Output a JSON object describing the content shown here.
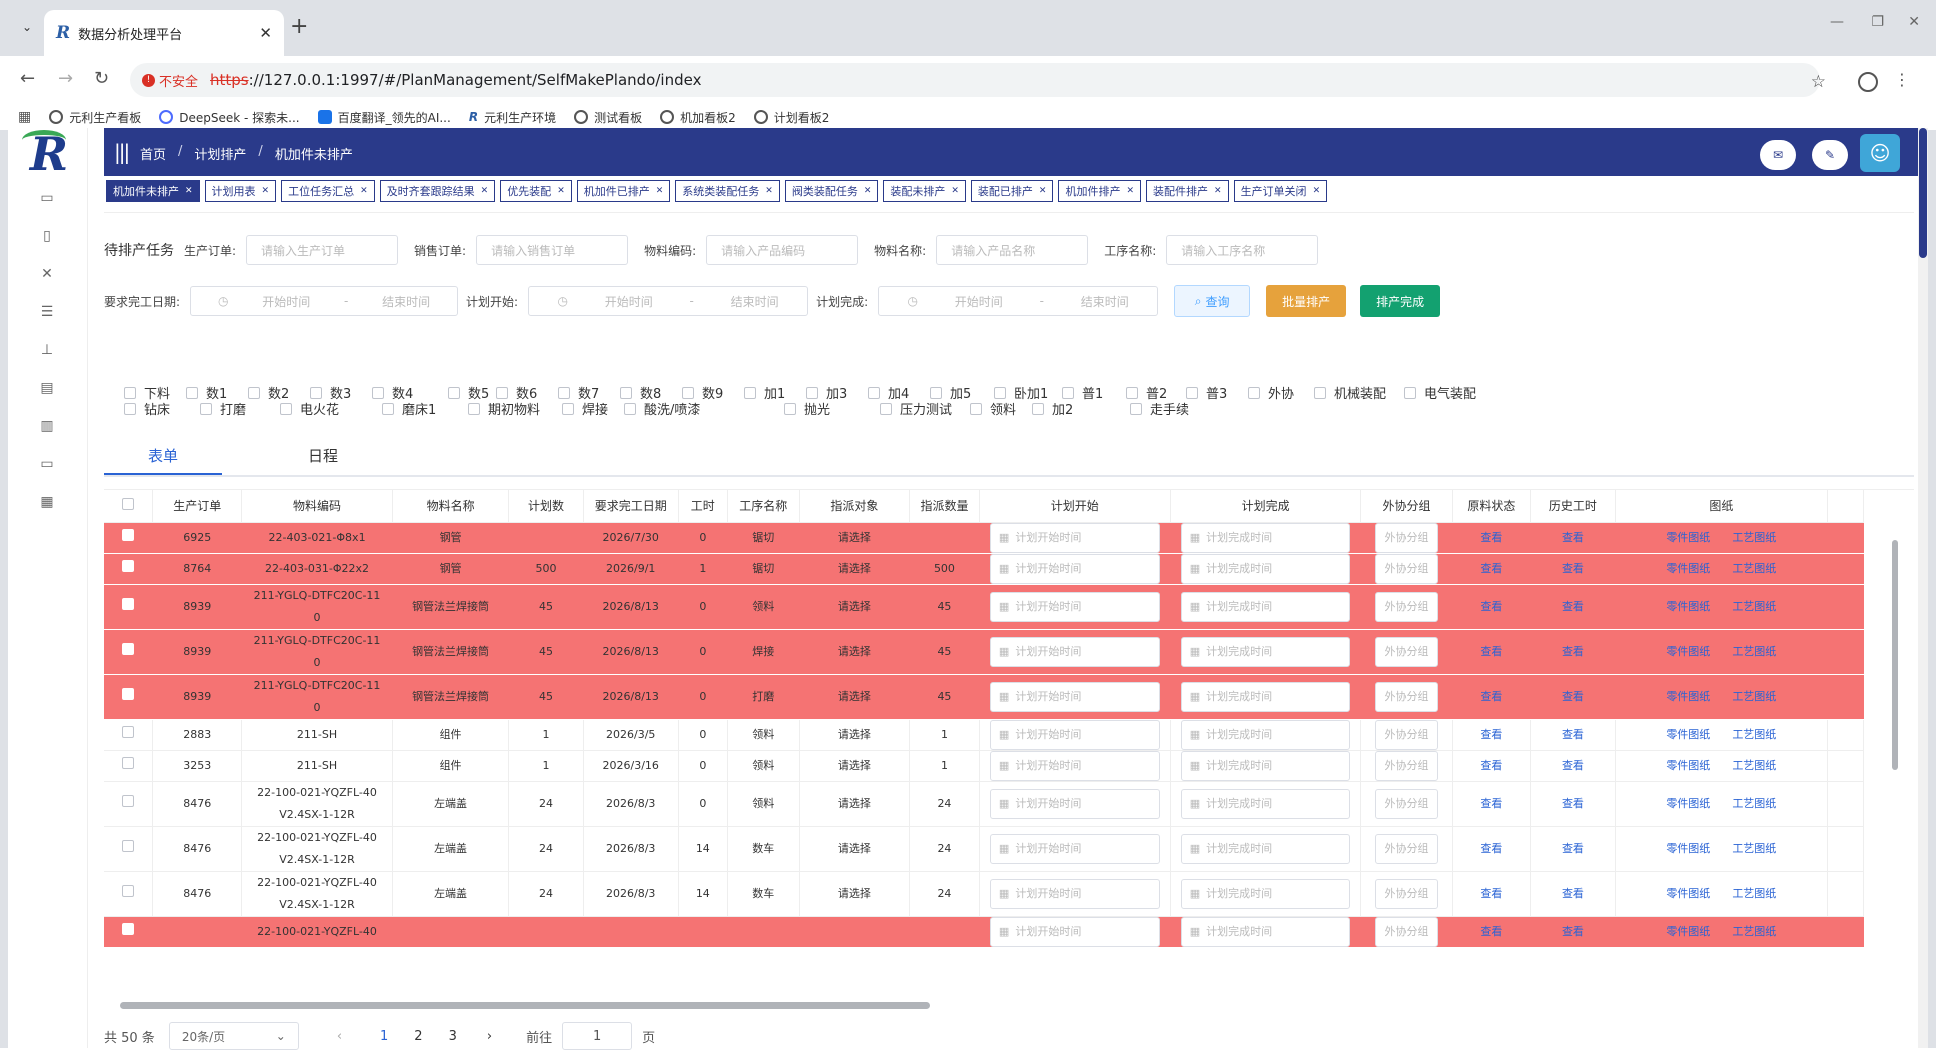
{
  "browser": {
    "tab_title": "数据分析处理平台",
    "insecure_label": "不安全",
    "url_scheme": "https",
    "url_rest": "://127.0.0.1:1997/#/PlanManagement/SelfMakePlando/index",
    "bookmarks": [
      "元利生产看板",
      "DeepSeek - 探索未...",
      "百度翻译_领先的AI...",
      "元利生产环境",
      "测试看板",
      "机加看板2",
      "计划看板2"
    ]
  },
  "header": {
    "breadcrumb": [
      "首页",
      "计划排产",
      "机加件未排产"
    ]
  },
  "tags": [
    "机加件未排产",
    "计划用表",
    "工位任务汇总",
    "及时齐套跟踪结果",
    "优先装配",
    "机加件已排产",
    "系统类装配任务",
    "阀类装配任务",
    "装配未排产",
    "装配已排产",
    "机加件排产",
    "装配件排产",
    "生产订单关闭"
  ],
  "filters": {
    "section_title": "待排产任务",
    "prod_order_label": "生产订单:",
    "prod_order_ph": "请输入生产订单",
    "sales_order_label": "销售订单:",
    "sales_order_ph": "请输入销售订单",
    "material_code_label": "物料编码:",
    "material_code_ph": "请输入产品编码",
    "material_name_label": "物料名称:",
    "material_name_ph": "请输入产品名称",
    "process_label": "工序名称:",
    "process_ph": "请输入工序名称",
    "req_date_label": "要求完工日期:",
    "plan_start_label": "计划开始:",
    "plan_done_label": "计划完成:",
    "start_ph": "开始时间",
    "end_ph": "结束时间",
    "dash": "-",
    "query_btn": "查询",
    "batch_btn": "批量排产",
    "done_btn": "排产完成"
  },
  "checkbox_row1": [
    "下料",
    "数1",
    "数2",
    "数3",
    "数4",
    "数5",
    "数6",
    "数7",
    "数8",
    "数9",
    "加1",
    "加3",
    "加4",
    "加5",
    "卧加1",
    "普1",
    "普2",
    "普3",
    "外协",
    "机械装配",
    "电气装配"
  ],
  "checkbox_row2": [
    "钻床",
    "打磨",
    "电火花",
    "磨床1",
    "期初物料",
    "焊接",
    "酸洗/喷漆",
    "抛光",
    "压力测试",
    "领料",
    "加2",
    "走手续"
  ],
  "view_tabs": [
    "表单",
    "日程"
  ],
  "table": {
    "headers": [
      "生产订单",
      "物料编码",
      "物料名称",
      "计划数",
      "要求完工日期",
      "工时",
      "工序名称",
      "指派对象",
      "指派数量",
      "计划开始",
      "计划完成",
      "外协分组",
      "原料状态",
      "历史工时",
      "图纸"
    ],
    "start_ph": "计划开始时间",
    "done_ph": "计划完成时间",
    "group_ph": "外协分组",
    "view_link": "查看",
    "part_drawing": "零件图纸",
    "process_drawing": "工艺图纸",
    "rows": [
      {
        "order": "6925",
        "code": "22-403-021-Φ8x1",
        "code2": "",
        "name": "钢管",
        "qty": "",
        "date": "2026/7/30",
        "hours": "0",
        "process": "锯切",
        "assignee": "请选择",
        "assign_qty": "",
        "red": true
      },
      {
        "order": "8764",
        "code": "22-403-031-Φ22x2",
        "code2": "",
        "name": "钢管",
        "qty": "500",
        "date": "2026/9/1",
        "hours": "1",
        "process": "锯切",
        "assignee": "请选择",
        "assign_qty": "500",
        "red": true
      },
      {
        "order": "8939",
        "code": "211-YGLQ-DTFC20C-11",
        "code2": "0",
        "name": "钢管法兰焊接筒",
        "qty": "45",
        "date": "2026/8/13",
        "hours": "0",
        "process": "领料",
        "assignee": "请选择",
        "assign_qty": "45",
        "red": true
      },
      {
        "order": "8939",
        "code": "211-YGLQ-DTFC20C-11",
        "code2": "0",
        "name": "钢管法兰焊接筒",
        "qty": "45",
        "date": "2026/8/13",
        "hours": "0",
        "process": "焊接",
        "assignee": "请选择",
        "assign_qty": "45",
        "red": true
      },
      {
        "order": "8939",
        "code": "211-YGLQ-DTFC20C-11",
        "code2": "0",
        "name": "钢管法兰焊接筒",
        "qty": "45",
        "date": "2026/8/13",
        "hours": "0",
        "process": "打磨",
        "assignee": "请选择",
        "assign_qty": "45",
        "red": true
      },
      {
        "order": "2883",
        "code": "211-SH",
        "code2": "",
        "name": "组件",
        "qty": "1",
        "date": "2026/3/5",
        "hours": "0",
        "process": "领料",
        "assignee": "请选择",
        "assign_qty": "1",
        "red": false
      },
      {
        "order": "3253",
        "code": "211-SH",
        "code2": "",
        "name": "组件",
        "qty": "1",
        "date": "2026/3/16",
        "hours": "0",
        "process": "领料",
        "assignee": "请选择",
        "assign_qty": "1",
        "red": false
      },
      {
        "order": "8476",
        "code": "22-100-021-YQZFL-40",
        "code2": "V2.4SX-1-12R",
        "name": "左端盖",
        "qty": "24",
        "date": "2026/8/3",
        "hours": "0",
        "process": "领料",
        "assignee": "请选择",
        "assign_qty": "24",
        "red": false
      },
      {
        "order": "8476",
        "code": "22-100-021-YQZFL-40",
        "code2": "V2.4SX-1-12R",
        "name": "左端盖",
        "qty": "24",
        "date": "2026/8/3",
        "hours": "14",
        "process": "数车",
        "assignee": "请选择",
        "assign_qty": "24",
        "red": false
      },
      {
        "order": "8476",
        "code": "22-100-021-YQZFL-40",
        "code2": "V2.4SX-1-12R",
        "name": "左端盖",
        "qty": "24",
        "date": "2026/8/3",
        "hours": "14",
        "process": "数车",
        "assignee": "请选择",
        "assign_qty": "24",
        "red": false
      },
      {
        "order": "",
        "code": "22-100-021-YQZFL-40",
        "code2": "",
        "name": "",
        "qty": "",
        "date": "",
        "hours": "",
        "process": "",
        "assignee": "",
        "assign_qty": "",
        "red": true
      }
    ]
  },
  "pager": {
    "total": "共 50 条",
    "page_size": "20条/页",
    "pages": [
      "1",
      "2",
      "3"
    ],
    "goto_label": "前往",
    "goto_value": "1",
    "page_unit": "页"
  },
  "colors": {
    "header_bg": "#2a3a8a",
    "row_red": "#f57373",
    "link": "#2a63d4",
    "batch": "#e6a23c",
    "done": "#13a170"
  }
}
